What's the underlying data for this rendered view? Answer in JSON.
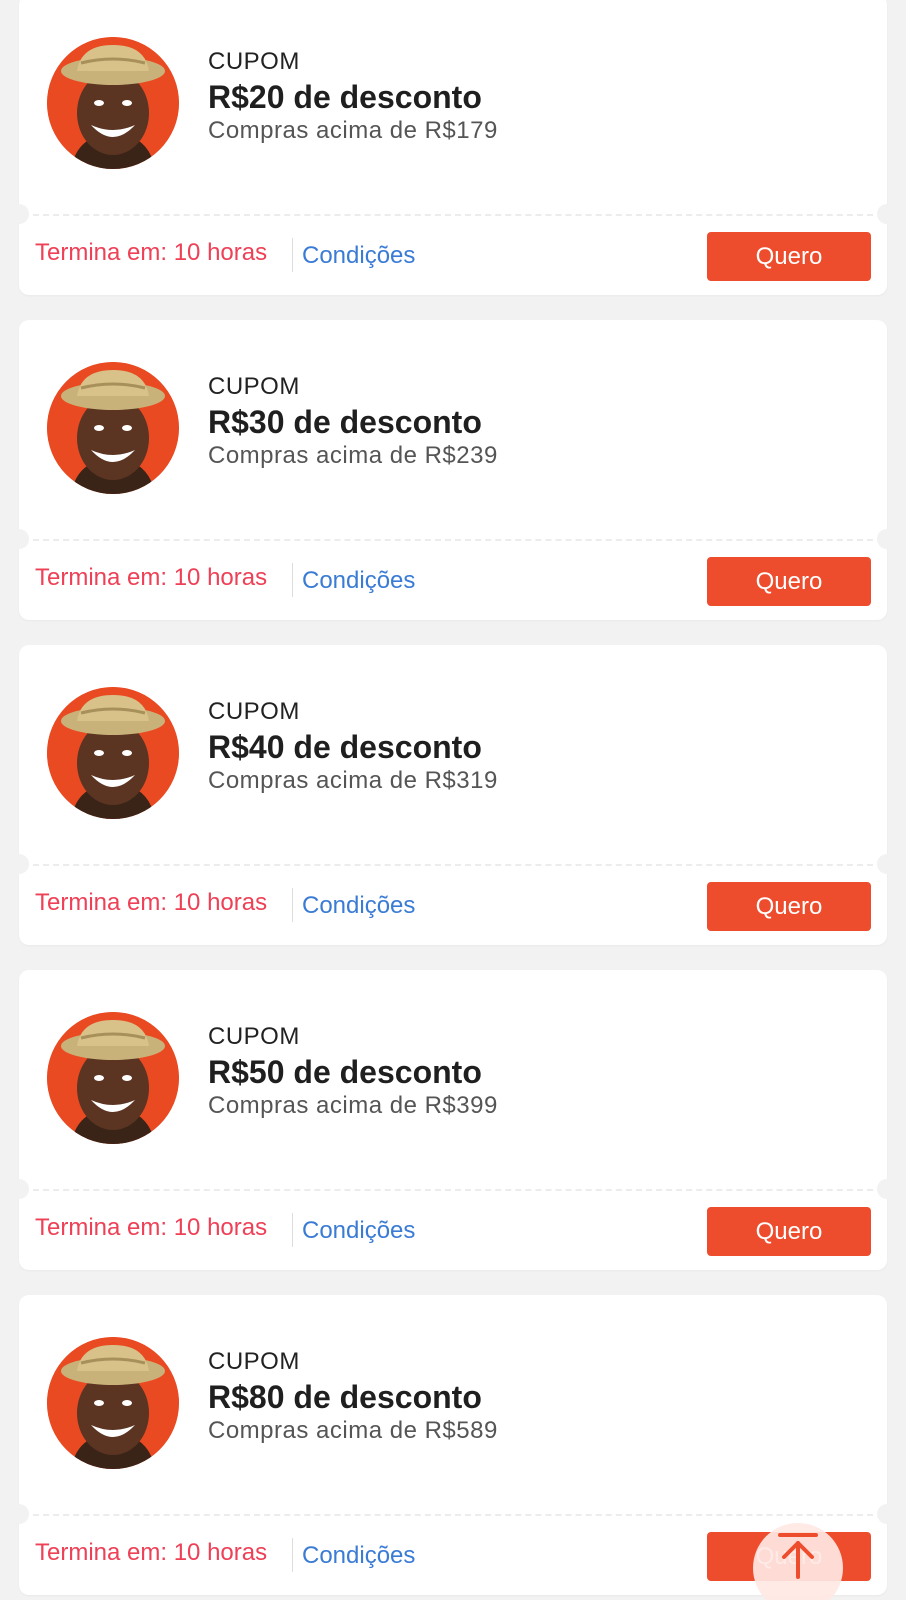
{
  "colors": {
    "accent": "#ee4d2d",
    "expiry_text": "#ee4056",
    "link": "#3a7bd5",
    "background": "#f2f2f2",
    "card": "#ffffff"
  },
  "coupons": [
    {
      "kicker": "CUPOM",
      "amount": "R$20 de desconto",
      "minimum": "Compras acima de R$179",
      "expires": "Termina em: 10 horas",
      "conditions": "Condições",
      "button": "Quero"
    },
    {
      "kicker": "CUPOM",
      "amount": "R$30 de desconto",
      "minimum": "Compras acima de R$239",
      "expires": "Termina em: 10 horas",
      "conditions": "Condições",
      "button": "Quero"
    },
    {
      "kicker": "CUPOM",
      "amount": "R$40 de desconto",
      "minimum": "Compras acima de R$319",
      "expires": "Termina em: 10 horas",
      "conditions": "Condições",
      "button": "Quero"
    },
    {
      "kicker": "CUPOM",
      "amount": "R$50 de desconto",
      "minimum": "Compras acima de R$399",
      "expires": "Termina em: 10 horas",
      "conditions": "Condições",
      "button": "Quero"
    },
    {
      "kicker": "CUPOM",
      "amount": "R$80 de desconto",
      "minimum": "Compras acima de R$589",
      "expires": "Termina em: 10 horas",
      "conditions": "Condições",
      "button": "Quero"
    }
  ],
  "back_to_top": {
    "icon": "arrow-up-to-top-icon"
  }
}
